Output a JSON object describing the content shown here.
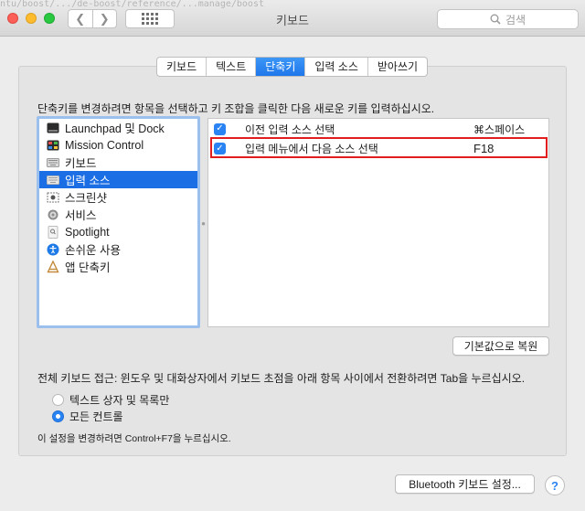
{
  "window": {
    "title": "키보드",
    "background_url_text": "ntu/boost/.../de-boost/reference/...manage/boost/..."
  },
  "search": {
    "placeholder": "검색"
  },
  "tabs": [
    {
      "label": "키보드",
      "active": false
    },
    {
      "label": "텍스트",
      "active": false
    },
    {
      "label": "단축키",
      "active": true
    },
    {
      "label": "입력 소스",
      "active": false
    },
    {
      "label": "받아쓰기",
      "active": false
    }
  ],
  "instruction": "단축키를 변경하려면 항목을 선택하고 키 조합을 클릭한 다음 새로운 키를 입력하십시오.",
  "categories": [
    {
      "label": "Launchpad 및 Dock",
      "icon": "launchpad-icon",
      "selected": false
    },
    {
      "label": "Mission Control",
      "icon": "mission-control-icon",
      "selected": false
    },
    {
      "label": "키보드",
      "icon": "keyboard-icon",
      "selected": false
    },
    {
      "label": "입력 소스",
      "icon": "input-source-icon",
      "selected": true
    },
    {
      "label": "스크린샷",
      "icon": "screenshot-icon",
      "selected": false
    },
    {
      "label": "서비스",
      "icon": "gear-icon",
      "selected": false
    },
    {
      "label": "Spotlight",
      "icon": "spotlight-icon",
      "selected": false
    },
    {
      "label": "손쉬운 사용",
      "icon": "accessibility-icon",
      "selected": false
    },
    {
      "label": "앱 단축키",
      "icon": "app-shortcuts-icon",
      "selected": false
    }
  ],
  "shortcuts": [
    {
      "checked": true,
      "label": "이전 입력 소스 선택",
      "key": "⌘스페이스"
    },
    {
      "checked": true,
      "label": "입력 메뉴에서 다음 소스 선택",
      "key": "F18"
    }
  ],
  "restore_defaults_label": "기본값으로 복원",
  "full_keyboard_access": {
    "label": "전체 키보드 접근: 윈도우 및 대화상자에서 키보드 초점을 아래 항목 사이에서 전환하려면 Tab을 누르십시오.",
    "options": [
      {
        "label": "텍스트 상자 및 목록만",
        "selected": false
      },
      {
        "label": "모든 컨트롤",
        "selected": true
      }
    ],
    "note": "이 설정을 변경하려면 Control+F7을 누르십시오."
  },
  "bluetooth_button_label": "Bluetooth 키보드 설정...",
  "help_label": "?",
  "colors": {
    "accent": "#1b6ee3",
    "highlight_border": "#e21d1d"
  }
}
